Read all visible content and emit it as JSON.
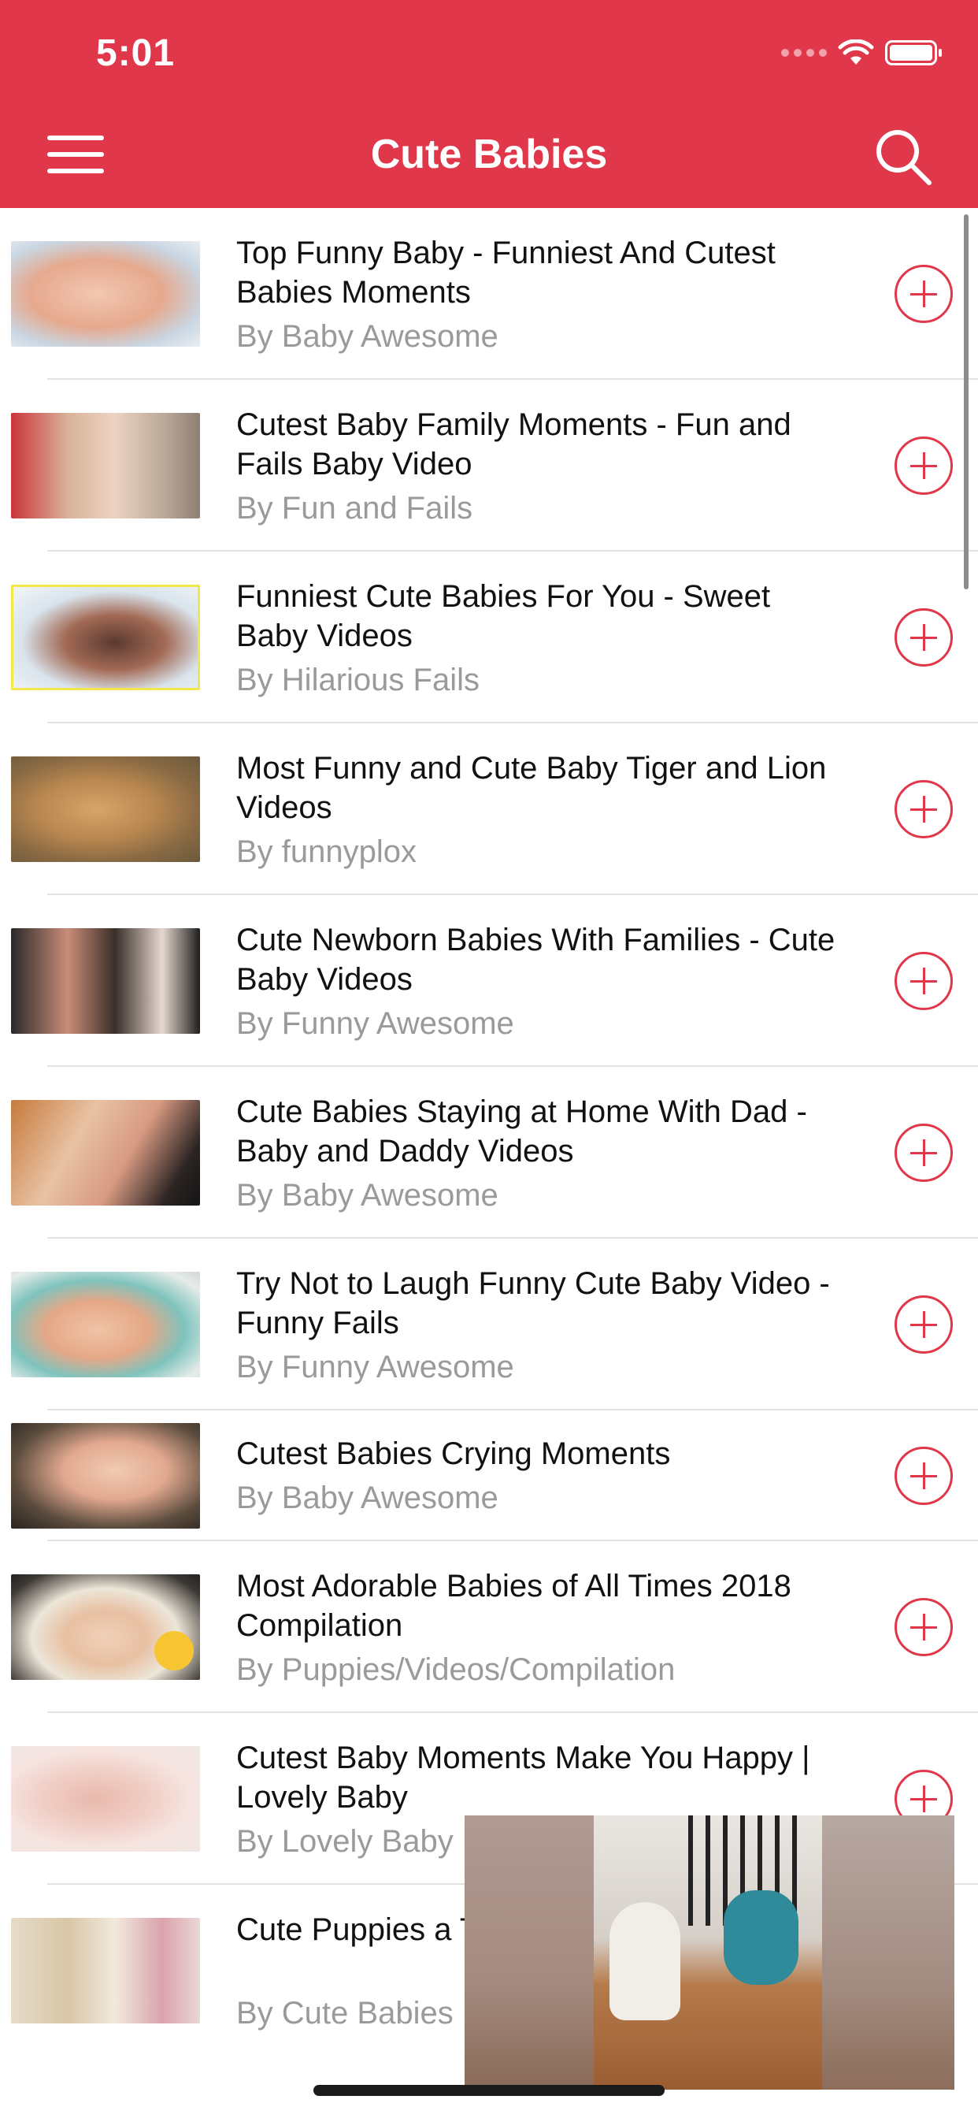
{
  "status_bar": {
    "time": "5:01"
  },
  "nav": {
    "title": "Cute Babies"
  },
  "colors": {
    "accent": "#e0374a",
    "author_gray": "#9a9a9a"
  },
  "icons": {
    "menu": "hamburger-menu-icon",
    "search": "search-icon",
    "add": "plus-circle-icon"
  },
  "videos": [
    {
      "title": "Top Funny Baby - Funniest And Cutest Babies Moments",
      "author": "By Baby Awesome"
    },
    {
      "title": "Cutest Baby Family Moments - Fun and Fails Baby Video",
      "author": "By Fun and Fails"
    },
    {
      "title": "Funniest Cute Babies For You - Sweet Baby Videos",
      "author": "By Hilarious Fails"
    },
    {
      "title": "Most Funny and Cute Baby Tiger and Lion Videos",
      "author": "By funnyplox"
    },
    {
      "title": "Cute Newborn Babies With Families - Cute Baby Videos",
      "author": "By Funny Awesome"
    },
    {
      "title": "Cute Babies Staying at Home With Dad - Baby and Daddy Videos",
      "author": "By Baby Awesome"
    },
    {
      "title": "Try Not to Laugh Funny Cute Baby Video -  Funny  Fails",
      "author": "By Funny Awesome"
    },
    {
      "title": "Cutest Babies Crying Moments",
      "author": "By Baby Awesome"
    },
    {
      "title": "Most Adorable Babies of All Times 2018 Compilation",
      "author": "By Puppies/Videos/Compilation"
    },
    {
      "title": "Cutest Baby Moments Make You Happy | Lovely Baby",
      "author": "By Lovely Baby"
    },
    {
      "title": "Cute Puppies a Together Comp",
      "author": "By Cute Babies"
    }
  ]
}
